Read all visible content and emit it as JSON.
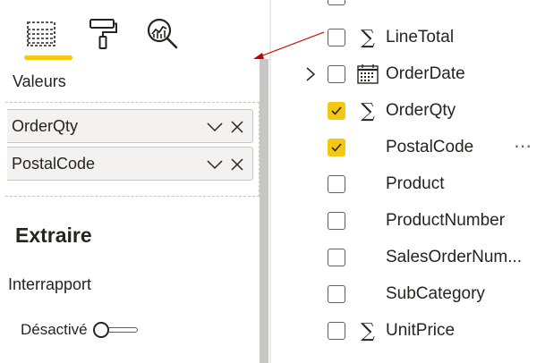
{
  "viz_pane": {
    "tabs": [
      {
        "name": "fields",
        "icon": "fields-grid-icon",
        "active": true
      },
      {
        "name": "format",
        "icon": "paint-roller-icon",
        "active": false
      },
      {
        "name": "analytics",
        "icon": "analytics-magnifier-icon",
        "active": false
      }
    ],
    "active_tab_color": "#f2c811",
    "values_label": "Valeurs",
    "values_wells": [
      {
        "label": "OrderQty",
        "chevron_icon": "chevron-down-icon",
        "close_icon": "close-icon"
      },
      {
        "label": "PostalCode",
        "chevron_icon": "chevron-down-icon",
        "close_icon": "close-icon"
      }
    ],
    "extract_heading": "Extraire",
    "cross_report_label": "Interrapport",
    "cross_report_toggle": {
      "state_label": "Désactivé",
      "on": false
    }
  },
  "fields_pane": {
    "fields": [
      {
        "name": "LineTotal",
        "checked": false,
        "type_icon": "sigma-icon",
        "expandable": false
      },
      {
        "name": "OrderDate",
        "checked": false,
        "type_icon": "calendar-icon",
        "expandable": true
      },
      {
        "name": "OrderQty",
        "checked": true,
        "type_icon": "sigma-icon",
        "expandable": false
      },
      {
        "name": "PostalCode",
        "checked": true,
        "type_icon": "",
        "expandable": false,
        "more_icon": "more-options-icon"
      },
      {
        "name": "Product",
        "checked": false,
        "type_icon": "",
        "expandable": false
      },
      {
        "name": "ProductNumber",
        "checked": false,
        "type_icon": "",
        "expandable": false
      },
      {
        "name": "SalesOrderNum...",
        "checked": false,
        "type_icon": "",
        "expandable": false
      },
      {
        "name": "SubCategory",
        "checked": false,
        "type_icon": "",
        "expandable": false
      },
      {
        "name": "UnitPrice",
        "checked": false,
        "type_icon": "sigma-icon",
        "expandable": false
      }
    ],
    "checkbox_checked_color": "#f2c811"
  },
  "annotation": {
    "arrow_color": "#c00000",
    "arrow_icon": "annotation-arrow-icon"
  }
}
